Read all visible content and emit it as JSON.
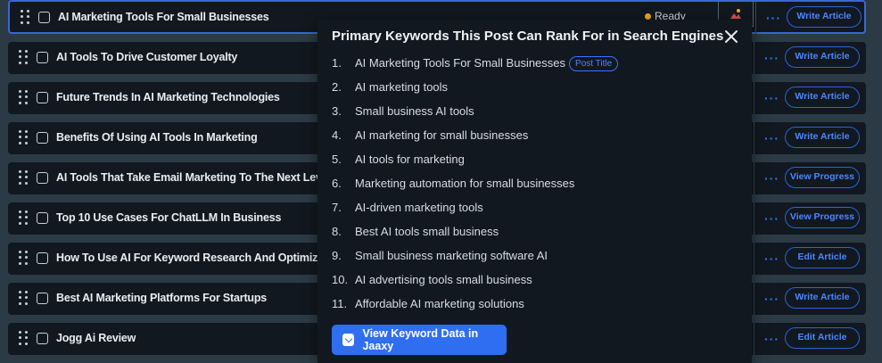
{
  "rows": [
    {
      "title": "AI Marketing Tools For Small Businesses",
      "status": "Ready",
      "action": "Write Article",
      "more": "···"
    },
    {
      "title": "AI Tools To Drive Customer Loyalty",
      "action": "Write Article",
      "more": "···"
    },
    {
      "title": "Future Trends In AI Marketing Technologies",
      "action": "Write Article",
      "more": "···"
    },
    {
      "title": "Benefits Of Using AI Tools In Marketing",
      "action": "Write Article",
      "more": "···"
    },
    {
      "title": "AI Tools That Take Email Marketing To The Next Level",
      "action": "View Progress",
      "more": "···"
    },
    {
      "title": "Top 10 Use Cases For ChatLLM In Business",
      "action": "View Progress",
      "more": "···"
    },
    {
      "title": "How To Use AI For Keyword Research And Optimization",
      "action": "Edit Article",
      "more": "···"
    },
    {
      "title": "Best AI Marketing Platforms For Startups",
      "action": "Write Article",
      "more": "···"
    },
    {
      "title": "Jogg Ai Review",
      "action": "Edit Article",
      "more": "···"
    }
  ],
  "popup": {
    "title": "Primary Keywords This Post Can Rank For in Search Engines",
    "keywords": [
      {
        "num": "1.",
        "text": "AI Marketing Tools For Small Businesses",
        "badge": "Post Title"
      },
      {
        "num": "2.",
        "text": "AI marketing tools"
      },
      {
        "num": "3.",
        "text": "Small business AI tools"
      },
      {
        "num": "4.",
        "text": "AI marketing for small businesses"
      },
      {
        "num": "5.",
        "text": "AI tools for marketing"
      },
      {
        "num": "6.",
        "text": "Marketing automation for small businesses"
      },
      {
        "num": "7.",
        "text": "AI-driven marketing tools"
      },
      {
        "num": "8.",
        "text": "Best AI tools small business"
      },
      {
        "num": "9.",
        "text": "Small business marketing software AI"
      },
      {
        "num": "10.",
        "text": "AI advertising tools small business"
      },
      {
        "num": "11.",
        "text": "Affordable AI marketing solutions"
      }
    ],
    "button_label": "View Keyword Data in Jaaxy"
  },
  "colors": {
    "accent": "#2f6ef0",
    "status_ready": "#f0a722",
    "row_bg": "#111820",
    "page_bg": "#2b3a45"
  }
}
